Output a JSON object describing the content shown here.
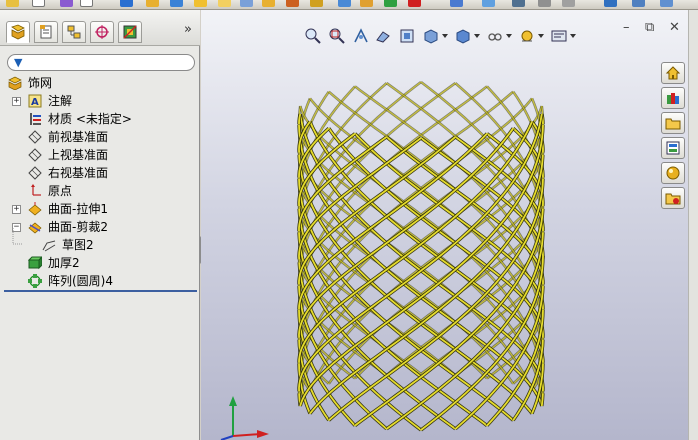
{
  "feature_tree": {
    "root": "饰网",
    "items": [
      {
        "label": "注解",
        "expander": "+"
      },
      {
        "label": "材质 <未指定>",
        "expander": ""
      },
      {
        "label": "前视基准面",
        "expander": ""
      },
      {
        "label": "上视基准面",
        "expander": ""
      },
      {
        "label": "右视基准面",
        "expander": ""
      },
      {
        "label": "原点",
        "expander": ""
      },
      {
        "label": "曲面-拉伸1",
        "expander": "+"
      },
      {
        "label": "曲面-剪裁2",
        "expander": "−"
      },
      {
        "label": "草图2",
        "expander": ""
      },
      {
        "label": "加厚2",
        "expander": ""
      },
      {
        "label": "阵列(圆周)4",
        "expander": ""
      }
    ]
  },
  "panel": {
    "expand_glyph": "»",
    "filter_glyph": "▼"
  },
  "window": {
    "minimize_glyph": "–",
    "restore_glyph": "⧉",
    "close_glyph": "✕"
  },
  "colors": {
    "mesh": "#e6dc2c",
    "mesh_edge": "#2a2a00",
    "selection_line": "#3c5fa0",
    "viewport_top": "#f2f3f7",
    "viewport_bottom": "#b4b6cc"
  },
  "icons": {
    "tabs": [
      "feature-manager-icon",
      "property-manager-icon",
      "configuration-manager-icon",
      "dimxpert-icon",
      "display-manager-icon"
    ],
    "view_toolbar": [
      "zoom-to-fit-icon",
      "zoom-to-area-icon",
      "previous-view-icon",
      "section-view-icon",
      "view-orientation-icon",
      "display-style-icon",
      "hide-show-items-icon",
      "edit-appearance-icon",
      "apply-scene-icon",
      "view-settings-icon"
    ],
    "task_pane": [
      "home-icon",
      "design-library-icon",
      "file-explorer-icon",
      "view-palette-icon",
      "appearances-icon",
      "custom-properties-icon"
    ]
  }
}
